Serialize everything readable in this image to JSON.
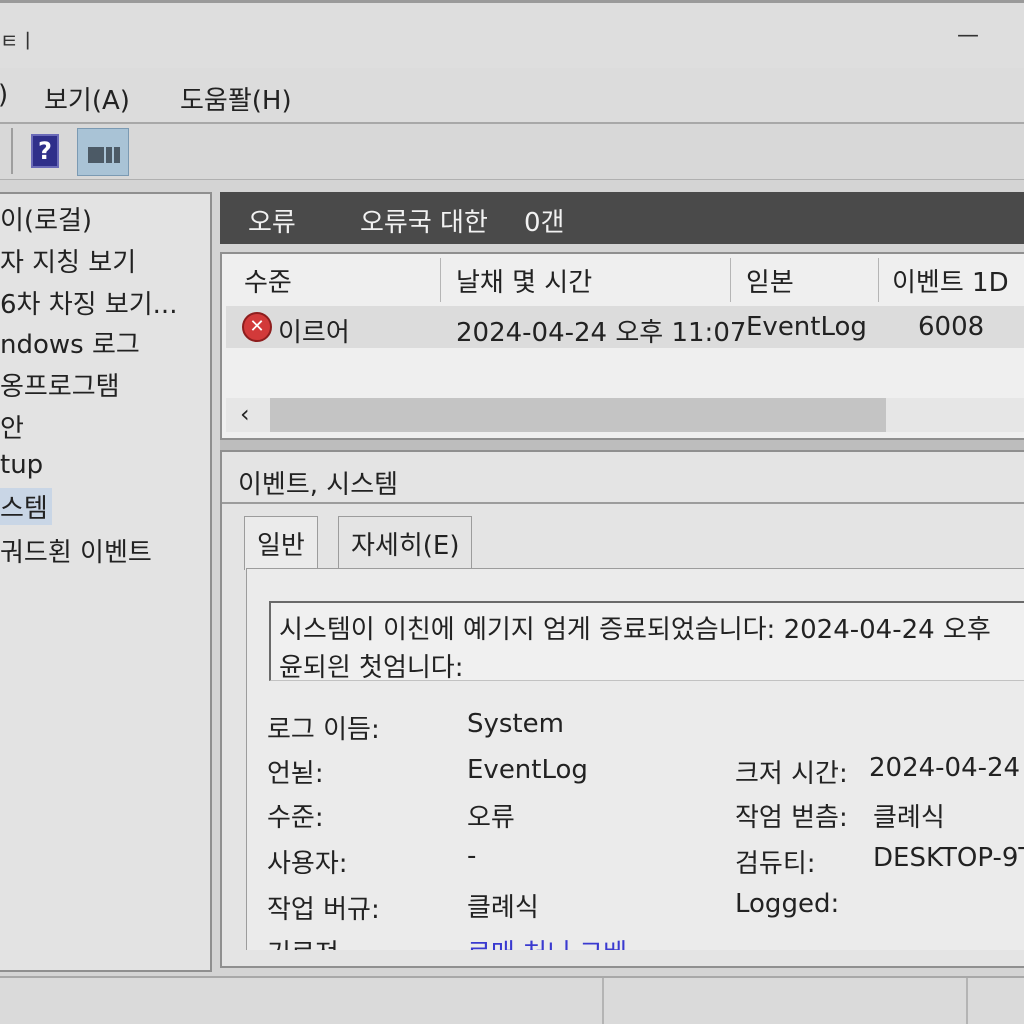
{
  "window": {
    "title": "ㅌㅣ",
    "minimize_glyph": "—"
  },
  "menu": [
    {
      "label": ")"
    },
    {
      "label": "보기(A)"
    },
    {
      "label": "도움퐐(H)"
    }
  ],
  "toolbar": {
    "help_glyph": "?",
    "help_icon": "help-icon",
    "panel_icon": "show-hide-pane-icon"
  },
  "tree": {
    "items": [
      {
        "label": "이(로걸)"
      },
      {
        "label": "자 지칭 보기"
      },
      {
        "label": "6차 차징 보기..."
      },
      {
        "label": "ndows 로그"
      },
      {
        "label": "옹프로그탬"
      },
      {
        "label": "안"
      },
      {
        "label": " tup"
      },
      {
        "label": "스템"
      },
      {
        "label": "궈드횐 이벤트"
      }
    ],
    "selected_index": 7
  },
  "header": {
    "name": "오류",
    "summary": "오류국 대한",
    "count": "0갠"
  },
  "list": {
    "columns": [
      "수준",
      "날채 몇 시간",
      "읻본",
      "이벤트 1D"
    ],
    "rows": [
      {
        "level_icon": "error-icon",
        "level": "이르어",
        "datetime": "2024-04-24 오후 11:07",
        "source": "EventLog",
        "event_id": "6008"
      }
    ],
    "scroll_left_glyph": "‹"
  },
  "details": {
    "title": "이벤트, 시스템",
    "tabs": [
      "일반",
      "자세히(E)"
    ],
    "message_line1": "시스템이 이친에 예기지 엄게 증료되었슴니다: 2024-04-24 오후",
    "message_line2": "윤되읜 첫엄니다:",
    "props": {
      "log_name_label": "로그 이듬:",
      "log_name_value": "System",
      "source_label": "언뇓:",
      "source_value": "EventLog",
      "level_label": "수준:",
      "level_value": "오류",
      "user_label": "사용자:",
      "user_value": "-",
      "opcode_label": "작업 버규:",
      "opcode_value": "클례식",
      "more_label": "기르져",
      "more_link": "로매 처니 그베",
      "logged_label": "크저 시간:",
      "logged_value": "2024-04-24 ",
      "task_label": "작엄 벋츰:",
      "task_value": "클례식",
      "computer_label": "검듀티:",
      "computer_value": "DESKTOP-9T",
      "keywords_label": "Logged:"
    }
  }
}
